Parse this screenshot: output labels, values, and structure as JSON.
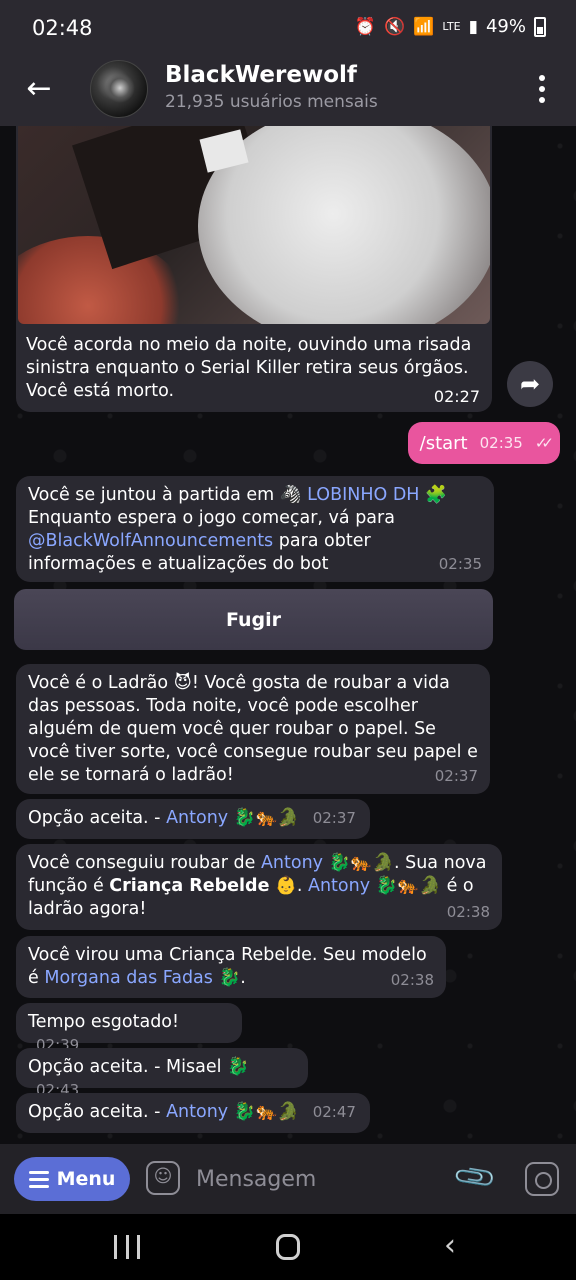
{
  "status": {
    "time": "02:48",
    "battery": "49%",
    "network": "LTE"
  },
  "header": {
    "title": "BlackWerewolf",
    "subtitle": "21,935 usuários mensais"
  },
  "messages": {
    "m1": {
      "text": "Você acorda no meio da noite, ouvindo uma risada sinistra enquanto o Serial Killer retira seus órgãos. Você está morto.",
      "time": "02:27"
    },
    "m2": {
      "text": "/start",
      "time": "02:35"
    },
    "m3": {
      "p1": "Você se juntou à partida em ",
      "emoji1": "🦓",
      "link1": "LOBINHO DH",
      "emoji2": "🧩",
      "p2": "Enquanto espera o jogo começar, vá para ",
      "link2": "@BlackWolfAnnouncements",
      "p3": " para obter informações e atualizações do bot",
      "time": "02:35"
    },
    "kb_button": "Fugir",
    "m4": {
      "p1": "Você é o Ladrão ",
      "emoji": "😈",
      "p2": "! Você gosta de roubar a vida das pessoas. Toda noite, você pode escolher alguém de quem você quer roubar o papel. Se você tiver sorte, você consegue roubar seu papel e ele se tornará o ladrão!",
      "time": "02:37"
    },
    "m5": {
      "prefix": "Opção aceita. - ",
      "name": "Antony",
      "emojis": "🐉🐅🐊",
      "time": "02:37"
    },
    "m6": {
      "p1": "Você conseguiu roubar de ",
      "name1": "Antony",
      "emojis1": "🐉🐅🐊",
      "p2": ". Sua nova função é ",
      "role": "Criança Rebelde",
      "emoji_role": "👶",
      "p3": ". ",
      "name2": "Antony",
      "emojis2": "🐉🐅🐊",
      "p4": " é o ladrão agora!",
      "time": "02:38"
    },
    "m7": {
      "p1": "Você virou uma Criança Rebelde. Seu modelo é ",
      "name": "Morgana das Fadas",
      "emoji": "🐉",
      "p2": ".",
      "time": "02:38"
    },
    "m8": {
      "text": "Tempo esgotado!",
      "time": "02:39"
    },
    "m9": {
      "text": "Opção aceita. - Misael",
      "emoji": "🐉",
      "time": "02:43"
    },
    "m10": {
      "prefix": "Opção aceita. - ",
      "name": "Antony",
      "emojis": "🐉🐅🐊",
      "time": "02:47"
    }
  },
  "input": {
    "menu_label": "Menu",
    "placeholder": "Mensagem"
  },
  "colors": {
    "accent_pink": "#e9559e",
    "link_blue": "#8aa7ff",
    "menu_blue": "#5b6ed6"
  }
}
